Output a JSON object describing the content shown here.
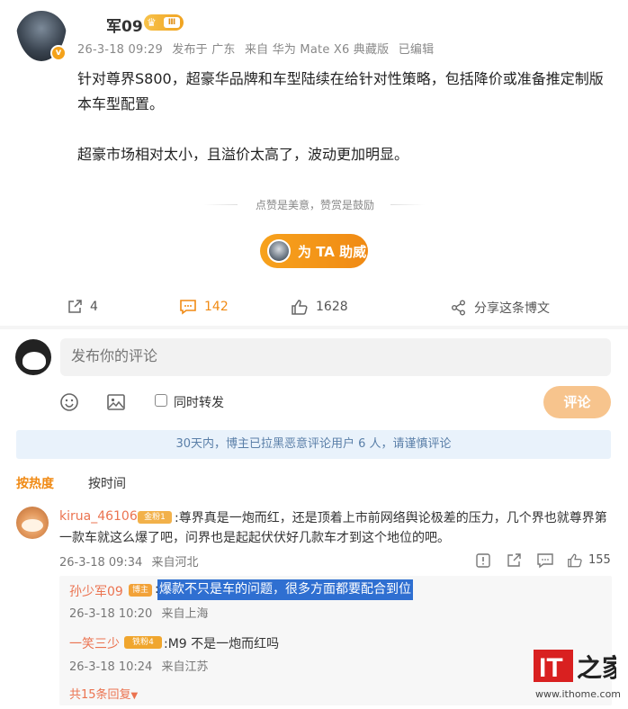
{
  "post": {
    "author": "军09",
    "vip_level": "Ⅲ",
    "verified_mark": "v",
    "meta": {
      "time": "26-3-18 09:29",
      "location": "发布于 广东",
      "source": "来自 华为 Mate X6 典藏版",
      "edited": "已编辑"
    },
    "paragraphs": [
      "针对尊界S800，超豪华品牌和车型陆续在给针对性策略，包括降价或准备推定制版本车型配置。",
      "超豪市场相对太小，且溢价太高了，波动更加明显。"
    ],
    "appreciate_text": "点赞是美意，赞赏是鼓励",
    "support_button": "为 TA 助威",
    "actions": {
      "share_count": "4",
      "comment_count": "142",
      "like_count": "1628",
      "forward_label": "分享这条博文"
    }
  },
  "composer": {
    "placeholder": "发布你的评论",
    "repost_label": "同时转发",
    "submit_label": "评论"
  },
  "notice": "30天内，博主已拉黑恶意评论用户 6 人，请谨慎评论",
  "sort": {
    "hot": "按热度",
    "time": "按时间"
  },
  "comment": {
    "user": "kirua_46106",
    "fan_badge": "金粉1",
    "text": ":尊界真是一炮而红，还是顶着上市前网络舆论极差的压力，几个界也就尊界第一款车就这么爆了吧，问界也是起起伏伏好几款车才到这个地位的吧。",
    "time": "26-3-18 09:34",
    "location": "来自河北",
    "like_count": "155"
  },
  "replies": [
    {
      "user": "孙少军09",
      "badge": "博主",
      "text": "爆款不只是车的问题，很多方面都要配合到位",
      "time": "26-3-18 10:20",
      "location": "来自上海"
    },
    {
      "user": "一笑三少",
      "badge": "铁粉4",
      "text": ":M9 不是一炮而红吗",
      "time": "26-3-18 10:24",
      "location": "来自江苏"
    }
  ],
  "more_replies": "共15条回复",
  "watermark": {
    "logo_text": "IT之家",
    "url": "www.ithome.com"
  },
  "colors": {
    "accent_orange": "#f08a14",
    "username": "#eb7350",
    "notice_bg": "#e9f2fb",
    "selection": "#2f6fd1"
  }
}
